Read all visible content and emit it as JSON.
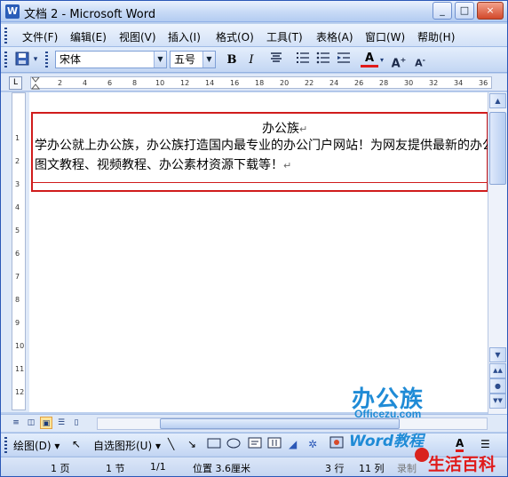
{
  "window": {
    "title": "文档 2 - Microsoft Word",
    "app_icon": "W",
    "buttons": {
      "minimize": "_",
      "maximize": "□",
      "close": "×"
    }
  },
  "menu": {
    "items": [
      "文件(F)",
      "编辑(E)",
      "视图(V)",
      "插入(I)",
      "格式(O)",
      "工具(T)",
      "表格(A)",
      "窗口(W)",
      "帮助(H)"
    ]
  },
  "toolbar": {
    "font_name": "宋体",
    "font_size": "五号",
    "bold": "B",
    "italic": "I",
    "font_color_label": "A",
    "grow_font": "A",
    "shrink_font": "A"
  },
  "ruler": {
    "ticks": [
      "2",
      "4",
      "6",
      "8",
      "10",
      "12",
      "14",
      "16",
      "18",
      "20",
      "22",
      "24",
      "26",
      "28",
      "30",
      "32",
      "34",
      "36"
    ],
    "corner": "L",
    "vticks": [
      "1",
      "2",
      "3",
      "4",
      "5",
      "6",
      "7",
      "8",
      "9",
      "10",
      "11",
      "12"
    ]
  },
  "document": {
    "header_title": "办公族",
    "header_line1": "学办公就上办公族，办公族打造国内最专业的办公门户网站！为网友提供最新的办公",
    "header_line2": "图文教程、视频教程、办公素材资源下载等！",
    "para_mark": "↵"
  },
  "drawbar": {
    "draw": "绘图(D)",
    "autoshapes": "自选图形(U)"
  },
  "status": {
    "page": "1 页",
    "section": "1 节",
    "pages": "1/1",
    "position": "位置 3.6厘米",
    "line": "3 行",
    "column": "11 列",
    "record": "录制"
  },
  "watermarks": {
    "logo": "办公族",
    "url": "Officezu.com",
    "word_tutorial": "Word教程",
    "life": "生活百科"
  },
  "colors": {
    "header_border": "#d01c1c",
    "accent": "#1f8bd6"
  }
}
